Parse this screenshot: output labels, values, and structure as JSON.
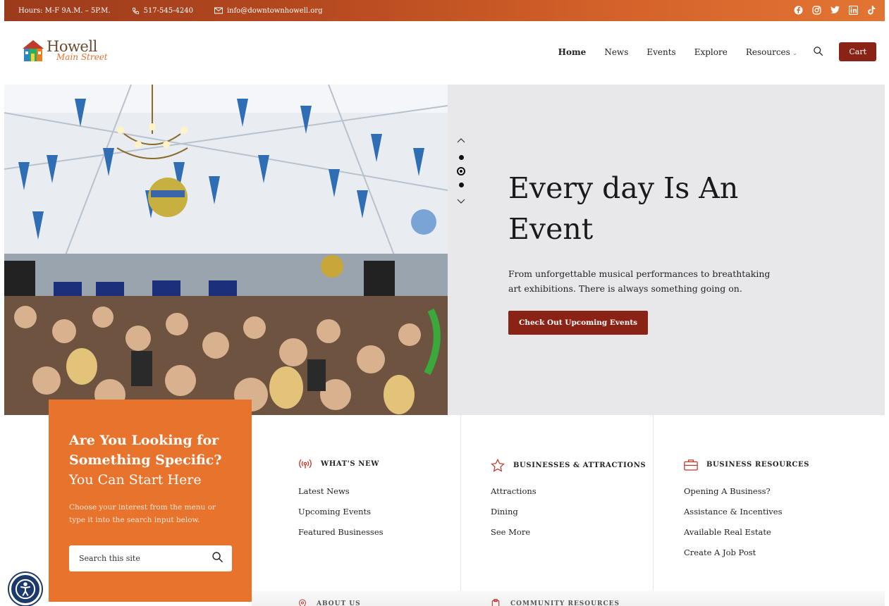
{
  "topbar": {
    "hours": "Hours: M-F 9A.M. – 5P.M.",
    "phone": "517-545-4240",
    "email": "info@downtownhowell.org",
    "social_icons": [
      "facebook-icon",
      "instagram-icon",
      "twitter-icon",
      "linkedin-icon",
      "tiktok-icon"
    ]
  },
  "logo": {
    "line1": "Howell",
    "line2": "Main Street"
  },
  "nav": {
    "items": [
      "Home",
      "News",
      "Events",
      "Explore",
      "Resources"
    ],
    "active": "Home",
    "cart_label": "Cart"
  },
  "hero": {
    "title": "Every day Is An Event",
    "description": "From unforgettable musical performances to breathtaking art exhibitions. There is always something going on.",
    "button_label": "Check Out Upcoming Events",
    "slides_count": 3,
    "active_slide": 2
  },
  "search_panel": {
    "heading_bold": "Are You Looking for Something Specific?",
    "heading_light": "You Can Start Here",
    "text": "Choose your interest from the menu or type it into the search input below.",
    "placeholder": "Search this site"
  },
  "columns": [
    {
      "title": "WHAT'S NEW",
      "icon": "broadcast-icon",
      "links": [
        "Latest News",
        "Upcoming Events",
        "Featured Businesses"
      ]
    },
    {
      "title": "BUSINESSES & ATTRACTIONS",
      "icon": "star-icon",
      "links": [
        "Attractions",
        "Dining",
        "See More"
      ]
    },
    {
      "title": "BUSINESS RESOURCES",
      "icon": "briefcase-icon",
      "links": [
        "Opening A Business?",
        "Assistance & Incentives",
        "Available Real Estate",
        "Create A Job Post"
      ]
    }
  ],
  "bottom_peek": [
    "ABOUT US",
    "COMMUNITY RESOURCES"
  ],
  "colors": {
    "brand_dark_red": "#8b2216",
    "orange": "#e8732c",
    "topbar_start": "#9c3b1c",
    "topbar_end": "#e27533"
  }
}
